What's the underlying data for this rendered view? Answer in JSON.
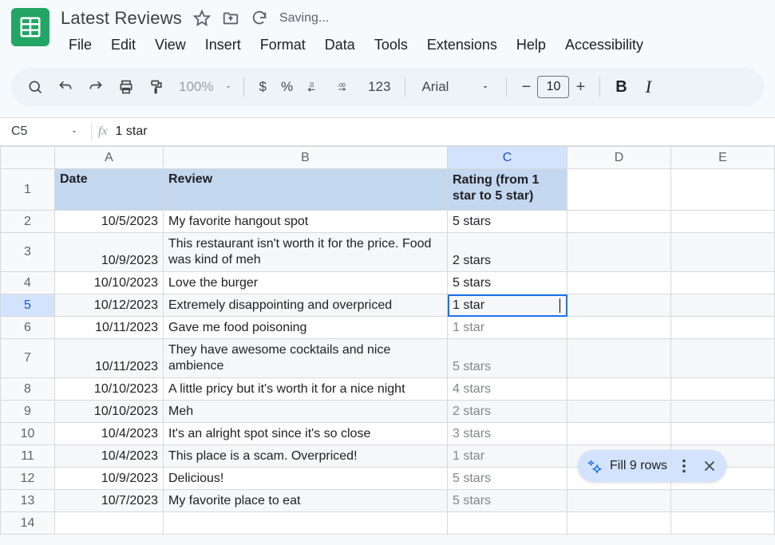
{
  "doc": {
    "title": "Latest Reviews",
    "status": "Saving..."
  },
  "menu": {
    "file": "File",
    "edit": "Edit",
    "view": "View",
    "insert": "Insert",
    "format": "Format",
    "data": "Data",
    "tools": "Tools",
    "extensions": "Extensions",
    "help": "Help",
    "accessibility": "Accessibility"
  },
  "toolbar": {
    "zoom": "100%",
    "currency": "$",
    "percent": "%",
    "decdec": ".0",
    "decinc": ".00",
    "num": "123",
    "font": "Arial",
    "size": "10",
    "bold": "B",
    "italic": "I"
  },
  "fx": {
    "cellref": "C5",
    "symbol": "fx",
    "content": "1 star"
  },
  "colHeaders": {
    "A": "A",
    "B": "B",
    "C": "C",
    "D": "D",
    "E": "E"
  },
  "headers": {
    "date": "Date",
    "review": "Review",
    "rating": "Rating (from 1 star to 5 star)"
  },
  "rows": [
    {
      "n": "1"
    },
    {
      "n": "2",
      "date": "10/5/2023",
      "review": "My favorite hangout spot",
      "rating": "5 stars"
    },
    {
      "n": "3",
      "date": "10/9/2023",
      "review": "This restaurant isn't worth it for the price. Food was kind of meh",
      "rating": "2 stars"
    },
    {
      "n": "4",
      "date": "10/10/2023",
      "review": "Love the burger",
      "rating": "5 stars"
    },
    {
      "n": "5",
      "date": "10/12/2023",
      "review": "Extremely disappointing and overpriced",
      "rating": "1 star"
    },
    {
      "n": "6",
      "date": "10/11/2023",
      "review": "Gave me food poisoning",
      "rating": "1 star"
    },
    {
      "n": "7",
      "date": "10/11/2023",
      "review": "They have awesome cocktails and nice ambience",
      "rating": "5 stars"
    },
    {
      "n": "8",
      "date": "10/10/2023",
      "review": "A little pricy but it's worth it for a nice night",
      "rating": "4 stars"
    },
    {
      "n": "9",
      "date": "10/10/2023",
      "review": "Meh",
      "rating": "2 stars"
    },
    {
      "n": "10",
      "date": "10/4/2023",
      "review": "It's an alright spot since it's so close",
      "rating": "3 stars"
    },
    {
      "n": "11",
      "date": "10/4/2023",
      "review": "This place is a scam. Overpriced!",
      "rating": "1 star"
    },
    {
      "n": "12",
      "date": "10/9/2023",
      "review": "Delicious!",
      "rating": "5 stars"
    },
    {
      "n": "13",
      "date": "10/7/2023",
      "review": "My favorite place to eat",
      "rating": "5 stars"
    },
    {
      "n": "14"
    }
  ],
  "pill": {
    "label": "Fill 9 rows"
  }
}
